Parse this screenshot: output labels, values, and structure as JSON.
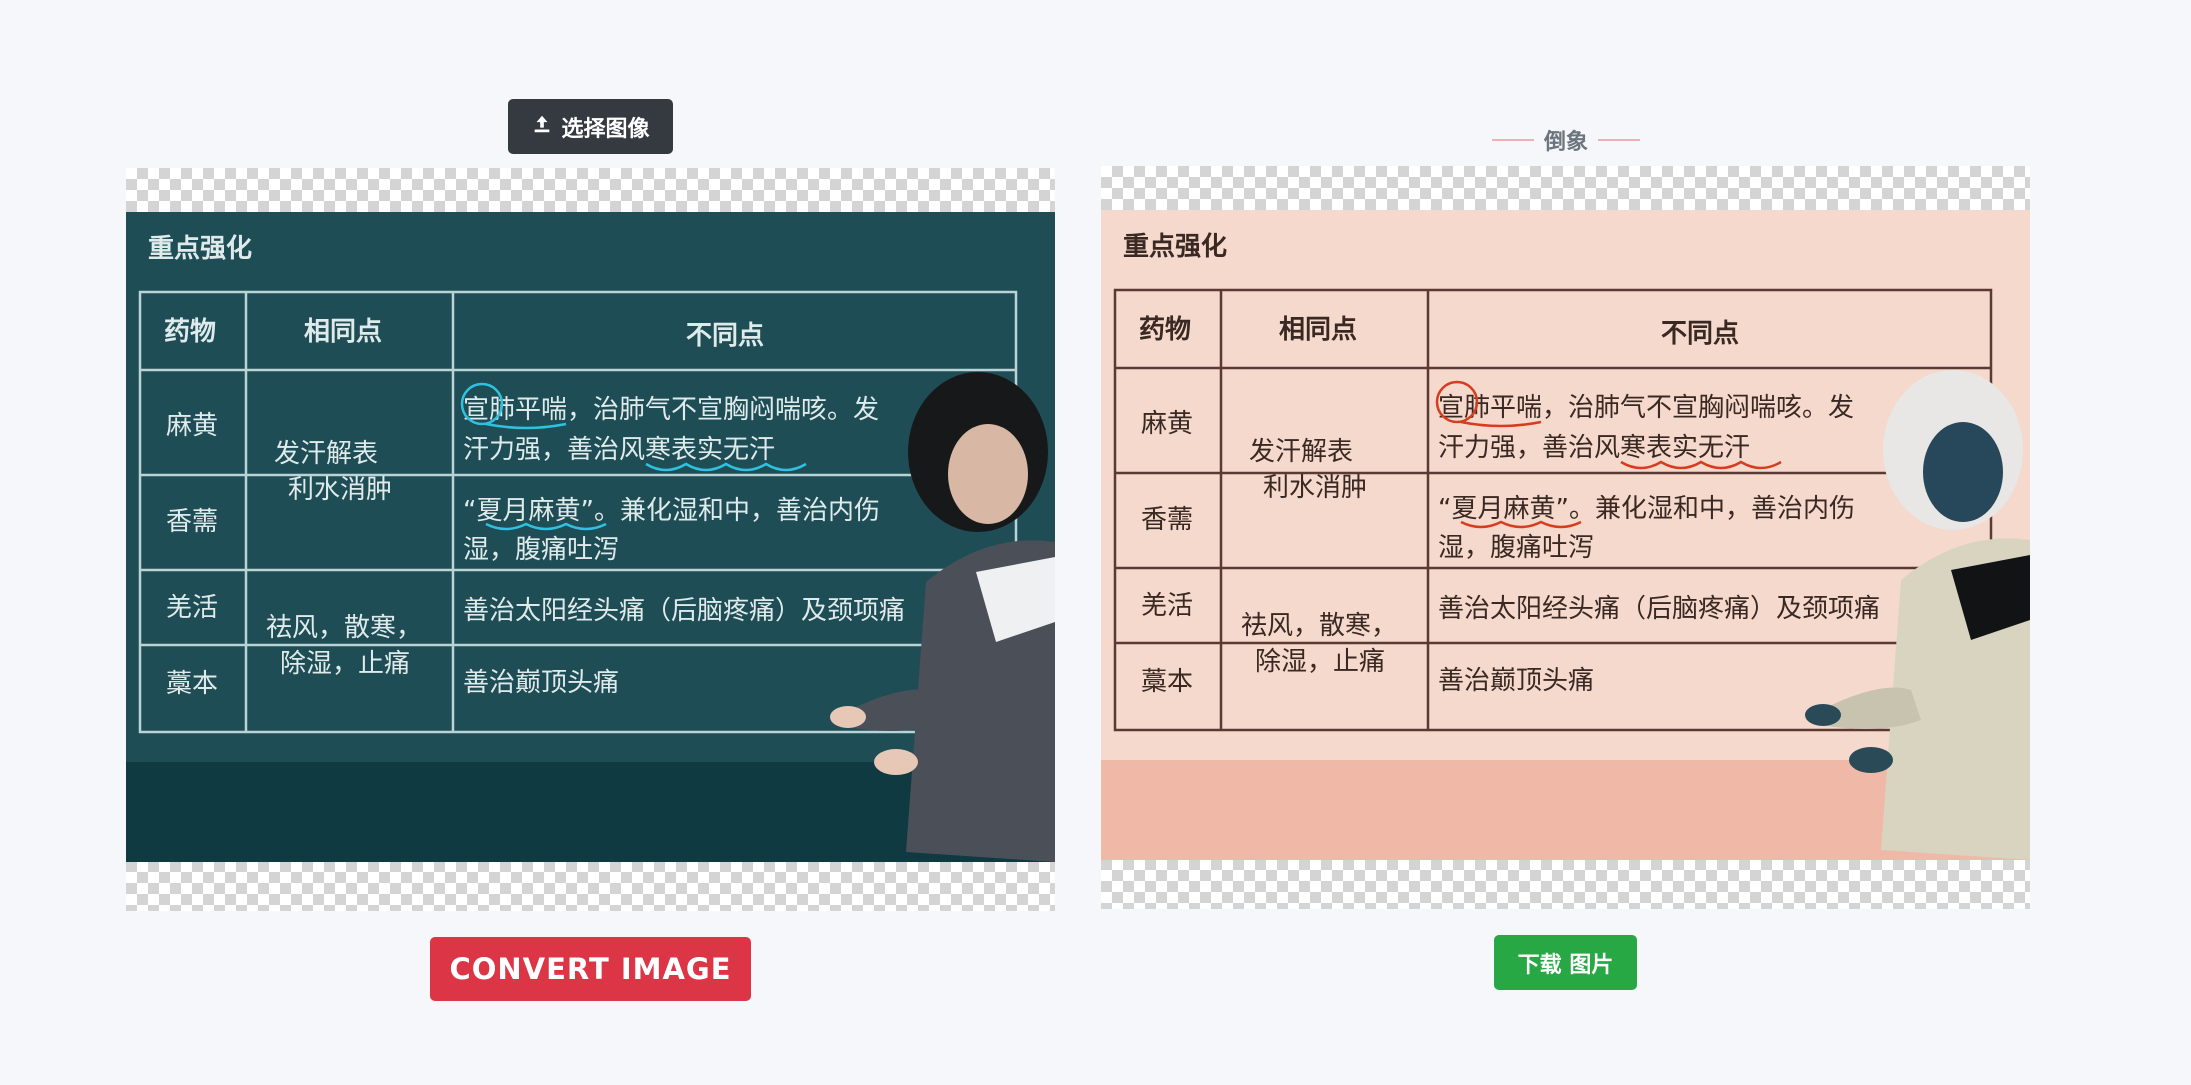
{
  "toolbar": {
    "select_image_label": "选择图像",
    "select_icon": "upload-icon"
  },
  "result": {
    "label": "倒象"
  },
  "actions": {
    "convert_label": "CONVERT IMAGE",
    "download_label": "下载 图片"
  },
  "board": {
    "heading": "重点强化",
    "headers": [
      "药物",
      "相同点",
      "不同点"
    ],
    "herbs": [
      "麻黄",
      "香薷",
      "羌活",
      "藁本"
    ],
    "common_group1": [
      "发汗解表",
      "利水消肿"
    ],
    "common_group2": [
      "祛风，散寒，",
      "除湿，止痛"
    ],
    "diff_lines": [
      "宣肺平喘，治肺气不宣胸闷喘咳。发",
      "汗力强，善治风寒表实无汗",
      "“夏月麻黄”。兼化湿和中，善治内伤",
      "湿，腹痛吐泻",
      "善治太阳经头痛（后脑疼痛）及颈项痛",
      "善治巅顶头痛"
    ]
  },
  "colors": {
    "original_board": "#1f4d55",
    "original_bottom": "#0f3a42",
    "inverted_board": "#f4d9cc",
    "inverted_bottom": "#f0b8a6",
    "convert_button": "#dc3545",
    "download_button": "#28a745",
    "select_button": "#343a40"
  }
}
